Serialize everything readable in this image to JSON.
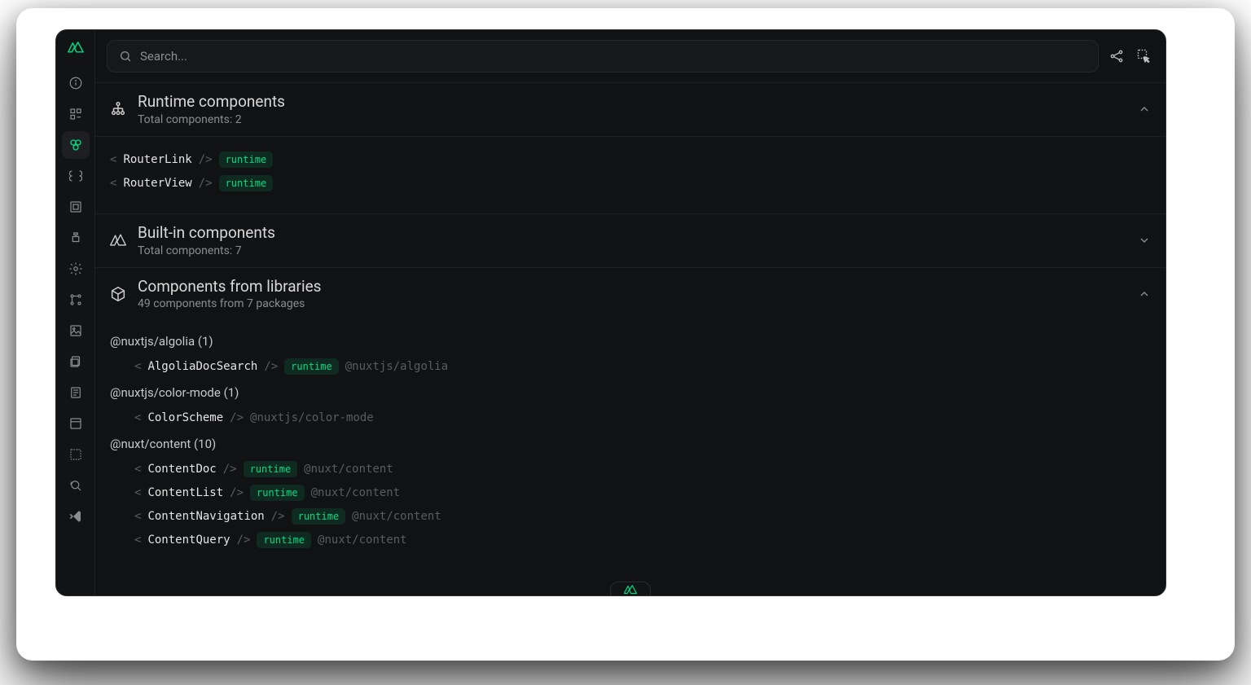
{
  "search": {
    "placeholder": "Search..."
  },
  "sections": {
    "runtime": {
      "title": "Runtime components",
      "subtitle": "Total components: 2",
      "expanded": true,
      "items": [
        {
          "name": "RouterLink",
          "tag": "runtime"
        },
        {
          "name": "RouterView",
          "tag": "runtime"
        }
      ]
    },
    "builtin": {
      "title": "Built-in components",
      "subtitle": "Total components: 7",
      "expanded": false
    },
    "libraries": {
      "title": "Components from libraries",
      "subtitle": "49 components from 7 packages",
      "expanded": true,
      "groups": [
        {
          "name": "@nuxtjs/algolia",
          "count": 1,
          "items": [
            {
              "name": "AlgoliaDocSearch",
              "tag": "runtime",
              "pkg": "@nuxtjs/algolia"
            }
          ]
        },
        {
          "name": "@nuxtjs/color-mode",
          "count": 1,
          "items": [
            {
              "name": "ColorScheme",
              "tag": null,
              "pkg": "@nuxtjs/color-mode"
            }
          ]
        },
        {
          "name": "@nuxt/content",
          "count": 10,
          "items": [
            {
              "name": "ContentDoc",
              "tag": "runtime",
              "pkg": "@nuxt/content"
            },
            {
              "name": "ContentList",
              "tag": "runtime",
              "pkg": "@nuxt/content"
            },
            {
              "name": "ContentNavigation",
              "tag": "runtime",
              "pkg": "@nuxt/content"
            },
            {
              "name": "ContentQuery",
              "tag": "runtime",
              "pkg": "@nuxt/content"
            }
          ]
        }
      ]
    }
  },
  "colors": {
    "accent": "#00dc82"
  }
}
